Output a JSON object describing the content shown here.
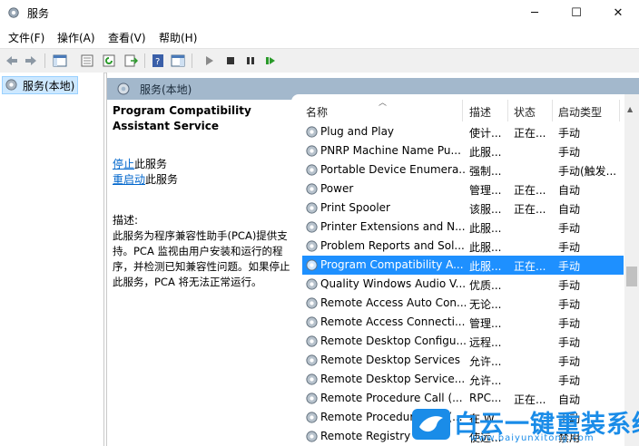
{
  "window": {
    "title": "服务"
  },
  "menu": [
    "文件(F)",
    "操作(A)",
    "查看(V)",
    "帮助(H)"
  ],
  "tree": {
    "selected": "服务(本地)"
  },
  "pane": {
    "header": "服务(本地)"
  },
  "detail": {
    "service_name": "Program Compatibility Assistant Service",
    "stop_link": "停止",
    "stop_suffix": "此服务",
    "restart_link": "重启动",
    "restart_suffix": "此服务",
    "desc_label": "描述:",
    "desc_text": "此服务为程序兼容性助手(PCA)提供支持。PCA 监视由用户安装和运行的程序，并检测已知兼容性问题。如果停止此服务，PCA 将无法正常运行。"
  },
  "columns": [
    "名称",
    "描述",
    "状态",
    "启动类型"
  ],
  "services": [
    {
      "name": "Plug and Play",
      "desc": "使计...",
      "status": "正在...",
      "startup": "手动"
    },
    {
      "name": "PNRP Machine Name Pu...",
      "desc": "此服...",
      "status": "",
      "startup": "手动"
    },
    {
      "name": "Portable Device Enumera...",
      "desc": "强制...",
      "status": "",
      "startup": "手动(触发..."
    },
    {
      "name": "Power",
      "desc": "管理...",
      "status": "正在...",
      "startup": "自动"
    },
    {
      "name": "Print Spooler",
      "desc": "该服...",
      "status": "正在...",
      "startup": "自动"
    },
    {
      "name": "Printer Extensions and N...",
      "desc": "此服...",
      "status": "",
      "startup": "手动"
    },
    {
      "name": "Problem Reports and Sol...",
      "desc": "此服...",
      "status": "",
      "startup": "手动"
    },
    {
      "name": "Program Compatibility A...",
      "desc": "此服...",
      "status": "正在...",
      "startup": "手动",
      "selected": true
    },
    {
      "name": "Quality Windows Audio V...",
      "desc": "优质...",
      "status": "",
      "startup": "手动"
    },
    {
      "name": "Remote Access Auto Con...",
      "desc": "无论...",
      "status": "",
      "startup": "手动"
    },
    {
      "name": "Remote Access Connecti...",
      "desc": "管理...",
      "status": "",
      "startup": "手动"
    },
    {
      "name": "Remote Desktop Configu...",
      "desc": "远程...",
      "status": "",
      "startup": "手动"
    },
    {
      "name": "Remote Desktop Services",
      "desc": "允许...",
      "status": "",
      "startup": "手动"
    },
    {
      "name": "Remote Desktop Service...",
      "desc": "允许...",
      "status": "",
      "startup": "手动"
    },
    {
      "name": "Remote Procedure Call (...",
      "desc": "RPC...",
      "status": "正在...",
      "startup": "自动"
    },
    {
      "name": "Remote Procedure Call (...",
      "desc": "在 W...",
      "status": "",
      "startup": "手动"
    },
    {
      "name": "Remote Registry",
      "desc": "使远...",
      "status": "",
      "startup": "禁用"
    }
  ],
  "watermark": {
    "brand": "白云一键重装系统",
    "url": "www.baiyunxitong.com"
  },
  "colors": {
    "selection": "#1e90ff",
    "pane_header": "#a3b8cc",
    "link": "#0066cc",
    "watermark": "#1a8ce8"
  }
}
